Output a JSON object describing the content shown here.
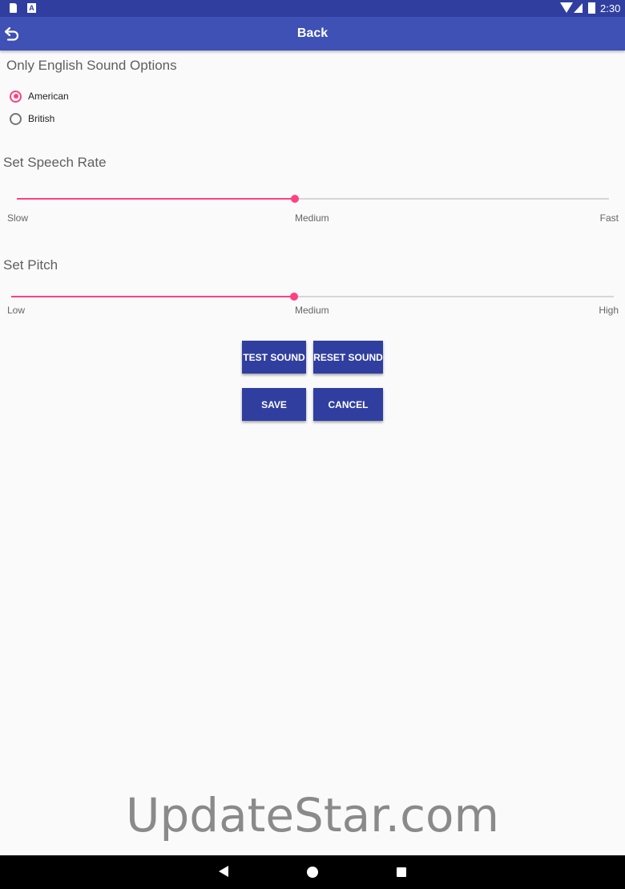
{
  "status_bar": {
    "time": "2:30",
    "notification_icon_letter": "A"
  },
  "app_bar": {
    "title": "Back",
    "back_icon": "back-arrow-icon"
  },
  "sound_options": {
    "title": "Only English Sound Options",
    "options": [
      {
        "label": "American",
        "checked": true
      },
      {
        "label": "British",
        "checked": false
      }
    ]
  },
  "speech_rate": {
    "title": "Set Speech Rate",
    "value_fraction": 0.47,
    "labels": {
      "min": "Slow",
      "mid": "Medium",
      "max": "Fast"
    }
  },
  "pitch": {
    "title": "Set Pitch",
    "value_fraction": 0.47,
    "labels": {
      "min": "Low",
      "mid": "Medium",
      "max": "High"
    }
  },
  "buttons": {
    "test_sound": "TEST SOUND",
    "reset_sound": "RESET SOUND",
    "save": "SAVE",
    "cancel": "CANCEL"
  },
  "watermark": "UpdateStar.com",
  "colors": {
    "primary": "#3f51b5",
    "primary_dark": "#303f9f",
    "accent": "#ff4081"
  }
}
